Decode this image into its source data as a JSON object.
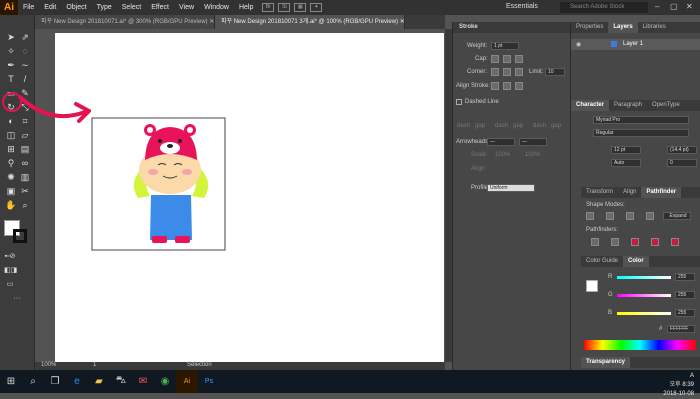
{
  "app": {
    "logo": "Ai",
    "menus": [
      "File",
      "Edit",
      "Object",
      "Type",
      "Select",
      "Effect",
      "View",
      "Window",
      "Help"
    ],
    "workspace": "Essentials",
    "search_placeholder": "Search Adobe Stock"
  },
  "tabs": [
    {
      "label": "피꾸 New Design 201810071.ai* @ 300% (RGB/GPU Preview)"
    },
    {
      "label": "피꾸 New Design 201810071  3개.ai* @ 100% (RGB/GPU Preview)"
    }
  ],
  "status": {
    "zoom": "100%",
    "page": "1",
    "tool": "Selection"
  },
  "stroke": {
    "title": "Stroke",
    "weight_label": "Weight:",
    "weight_value": "1 pt",
    "cap_label": "Cap:",
    "corner_label": "Corner:",
    "limit_label": "Limit:",
    "limit_value": "10",
    "align_label": "Align Stroke:",
    "dashed_label": "Dashed Line",
    "dash_labels": [
      "dash",
      "gap",
      "dash",
      "gap",
      "dash",
      "gap"
    ],
    "arrowheads_label": "Arrowheads:",
    "scale_label": "Scale:",
    "scale_values": [
      "100%",
      "100%"
    ],
    "align_label2": "Align:",
    "profile_label": "Profile:",
    "profile_value": "Uniform"
  },
  "right": {
    "top_tabs": [
      "Properties",
      "Layers",
      "Libraries"
    ],
    "layer_name": "Layer 1",
    "char_tabs": [
      "Character",
      "Paragraph",
      "OpenType"
    ],
    "font_search": "Myriad Pro",
    "font_style": "Regular",
    "size": "12 pt",
    "leading": "(14.4 pt)",
    "kerning": "Auto",
    "tracking": "0",
    "pf_tabs": [
      "Transform",
      "Align",
      "Pathfinder"
    ],
    "shape_modes": "Shape Modes:",
    "expand": "Expand",
    "pathfinders": "Pathfinders:",
    "color_tabs": [
      "Color Guide",
      "Color"
    ],
    "r_label": "R",
    "g_label": "G",
    "b_label": "B",
    "r_value": "255",
    "g_value": "255",
    "b_value": "255",
    "hex": "FFFFFF",
    "transparency": "Transparency"
  },
  "taskbar": {
    "time": "오후 8:39",
    "date": "2018-10-08",
    "lang": "A"
  }
}
